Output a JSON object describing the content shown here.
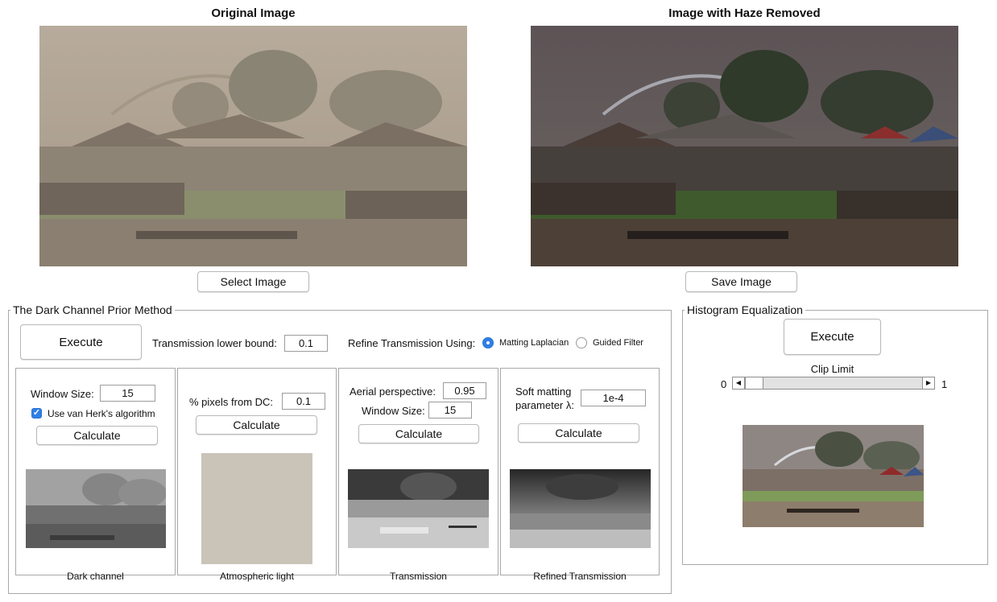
{
  "original": {
    "title": "Original Image",
    "select_label": "Select Image"
  },
  "dehazed": {
    "title": "Image with Haze Removed",
    "save_label": "Save Image"
  },
  "dcp": {
    "panel_title": "The Dark Channel Prior Method",
    "execute_label": "Execute",
    "lower_bound_label": "Transmission lower bound:",
    "lower_bound_value": "0.1",
    "refine_label": "Refine Transmission Using:",
    "refine_options": [
      {
        "label": "Matting Laplacian",
        "selected": true
      },
      {
        "label": "Guided Filter",
        "selected": false
      }
    ],
    "dark_channel": {
      "window_label": "Window Size:",
      "window_value": "15",
      "vanherk_label": "Use van Herk's algorithm",
      "vanherk_checked": true,
      "calculate_label": "Calculate",
      "caption": "Dark channel"
    },
    "atmospheric": {
      "pixels_label": "% pixels from DC:",
      "pixels_value": "0.1",
      "calculate_label": "Calculate",
      "caption": "Atmospheric light",
      "color": "#cac4b8"
    },
    "transmission": {
      "aerial_label": "Aerial perspective:",
      "aerial_value": "0.95",
      "window_label": "Window Size:",
      "window_value": "15",
      "calculate_label": "Calculate",
      "caption": "Transmission"
    },
    "refined": {
      "lambda_label_line1": "Soft matting",
      "lambda_label_line2": "parameter λ:",
      "lambda_value": "1e-4",
      "calculate_label": "Calculate",
      "caption": "Refined Transmission"
    }
  },
  "histeq": {
    "panel_title": "Histogram Equalization",
    "execute_label": "Execute",
    "clip_label": "Clip Limit",
    "clip_min": "0",
    "clip_max": "1",
    "clip_value": 0.02
  },
  "icons": {
    "checkbox": "checkmark-icon",
    "slider_left": "arrow-left-icon",
    "slider_right": "arrow-right-icon"
  }
}
